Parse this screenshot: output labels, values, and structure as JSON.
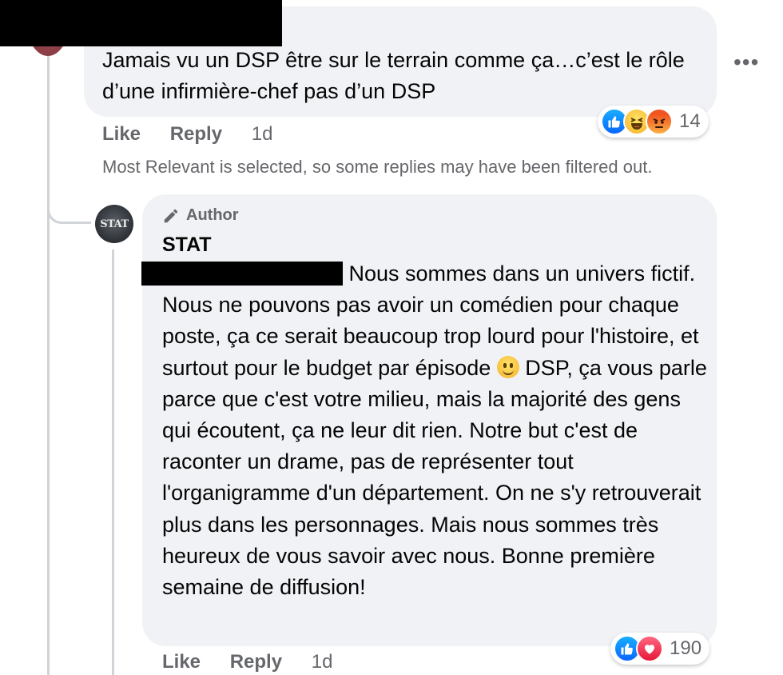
{
  "comment": {
    "text": "Jamais vu un DSP être sur le terrain comme ça…c’est le rôle d’une infirmière-chef pas d’un DSP",
    "more_icon": "more-horizontal-icon",
    "actions": {
      "like": "Like",
      "reply": "Reply",
      "time": "1d"
    },
    "reactions": {
      "icons": [
        "like-icon",
        "haha-icon",
        "angry-icon"
      ],
      "count": "14"
    }
  },
  "filter_note": "Most Relevant is selected, so some replies may have been filtered out.",
  "reply": {
    "avatar_text": "STAT",
    "author_badge": "Author",
    "author_icon": "pencil-icon",
    "name": "STAT",
    "text_before_emoji": " Nous sommes dans un univers fictif. Nous ne pouvons pas avoir un comédien pour chaque poste, ça ce serait beaucoup trop lourd pour l'histoire, et surtout pour le budget par épisode ",
    "emoji": "smile-icon",
    "text_after_emoji": " DSP, ça vous parle parce que c'est votre milieu, mais la majorité des gens qui écoutent, ça ne leur dit rien. Notre but c'est de raconter un drame, pas de représenter tout l'organigramme d'un département. On ne s'y retrouverait plus dans les personnages. Mais nous sommes très heureux de vous savoir avec nous. Bonne première semaine de diffusion!",
    "actions": {
      "like": "Like",
      "reply": "Reply",
      "time": "1d"
    },
    "reactions": {
      "icons": [
        "like-icon",
        "love-icon"
      ],
      "count": "190"
    }
  },
  "colors": {
    "bubble": "#f0f2f5",
    "secondary_text": "#65676b",
    "like_blue": "#0866ff",
    "love_red": "#e61739"
  }
}
